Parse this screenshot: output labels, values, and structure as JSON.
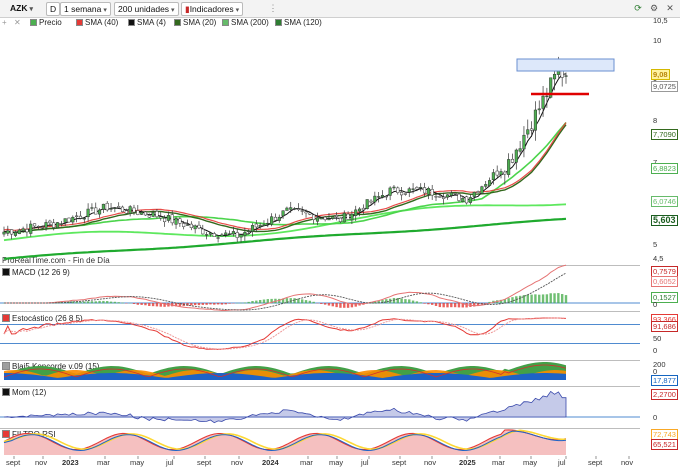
{
  "toolbar": {
    "ticker": "AZK",
    "type_button": "D",
    "period": "1 semana",
    "units": "200 unidades",
    "indicators": "Indicadores"
  },
  "legend": [
    {
      "label": "Precio",
      "color": "#2e7d32"
    },
    {
      "label": "SMA (40)",
      "color": "#e53935"
    },
    {
      "label": "SMA (4)",
      "color": "#111111"
    },
    {
      "label": "SMA (20)",
      "color": "#33691e"
    },
    {
      "label": "SMA (200)",
      "color": "#66bb6a"
    },
    {
      "label": "SMA (120)",
      "color": "#2e7d32"
    }
  ],
  "watermark": "ProRealTime.com - Fin de Día",
  "price_axis": {
    "ticks": [
      "10,5",
      "10",
      "9",
      "8",
      "7",
      "6",
      "5",
      "4,5"
    ],
    "tags": [
      {
        "text": "9,08",
        "color": "#b8860b",
        "bg": "#fff3a0"
      },
      {
        "text": "9,0725",
        "color": "#555555",
        "bg": "#ffffff"
      },
      {
        "text": "7,7090",
        "color": "#33691e",
        "bg": "#ffffff"
      },
      {
        "text": "6,8823",
        "color": "#4caf50",
        "bg": "#ffffff"
      },
      {
        "text": "6,0746",
        "color": "#66bb6a",
        "bg": "#ffffff"
      },
      {
        "text": "5,603",
        "color": "#1b5e20",
        "bg": "#ffffff"
      }
    ]
  },
  "panels": {
    "macd": {
      "title": "MACD (12 26 9)",
      "tags": [
        "0,7579",
        "0,6052",
        "0,1527"
      ],
      "ticks": [
        "0"
      ]
    },
    "stoch": {
      "title": "Estocástico (26 8 5)",
      "tags": [
        "93,366",
        "91,686"
      ],
      "ticks": [
        "50",
        "0"
      ]
    },
    "koncorde": {
      "title": "Blai5 Koncorde v.09 (15)",
      "tags": [
        "17,877"
      ],
      "ticks": [
        "200",
        "0"
      ]
    },
    "mom": {
      "title": "Mom (12)",
      "tags": [
        "2,2700"
      ],
      "ticks": [
        "0"
      ]
    },
    "rsi": {
      "title": "FILTRO RSI",
      "tags": [
        "72,743",
        "65,521"
      ],
      "ticks": []
    }
  },
  "x_axis": {
    "labels": [
      "sept",
      "nov",
      "2023",
      "mar",
      "may",
      "jul",
      "sept",
      "nov",
      "2024",
      "mar",
      "may",
      "jul",
      "sept",
      "nov",
      "2025",
      "mar",
      "may",
      "jul",
      "sept",
      "nov"
    ],
    "bold": [
      "2023",
      "2024",
      "2025"
    ]
  },
  "chart_data": {
    "type": "candlestick",
    "title": "AZK",
    "period": "1 semana",
    "xlabel": "",
    "ylabel": "",
    "ylim": [
      4.5,
      10.5
    ],
    "approx_close_path": [
      {
        "date": "2022-09",
        "value": 5.3
      },
      {
        "date": "2022-12",
        "value": 5.5
      },
      {
        "date": "2023-03",
        "value": 5.9
      },
      {
        "date": "2023-06",
        "value": 5.7
      },
      {
        "date": "2023-09",
        "value": 5.3
      },
      {
        "date": "2023-11",
        "value": 5.2
      },
      {
        "date": "2024-02",
        "value": 5.8
      },
      {
        "date": "2024-05",
        "value": 5.6
      },
      {
        "date": "2024-08",
        "value": 6.3
      },
      {
        "date": "2024-10",
        "value": 6.3
      },
      {
        "date": "2025-01",
        "value": 6.1
      },
      {
        "date": "2025-03",
        "value": 7.0
      },
      {
        "date": "2025-05",
        "value": 8.3
      },
      {
        "date": "2025-06",
        "value": 9.08
      }
    ],
    "last_close": 9.08,
    "last_open": 9.0725,
    "series": [
      {
        "name": "SMA (4)",
        "last": 9.0725
      },
      {
        "name": "SMA (20)",
        "last": 7.709
      },
      {
        "name": "SMA (40)",
        "last": 6.8823
      },
      {
        "name": "SMA (120)",
        "last": 6.0746
      },
      {
        "name": "SMA (200)",
        "last": 5.603
      }
    ]
  },
  "icons": [
    "gear-icon",
    "close-icon",
    "tool-icon",
    "sync-icon"
  ]
}
